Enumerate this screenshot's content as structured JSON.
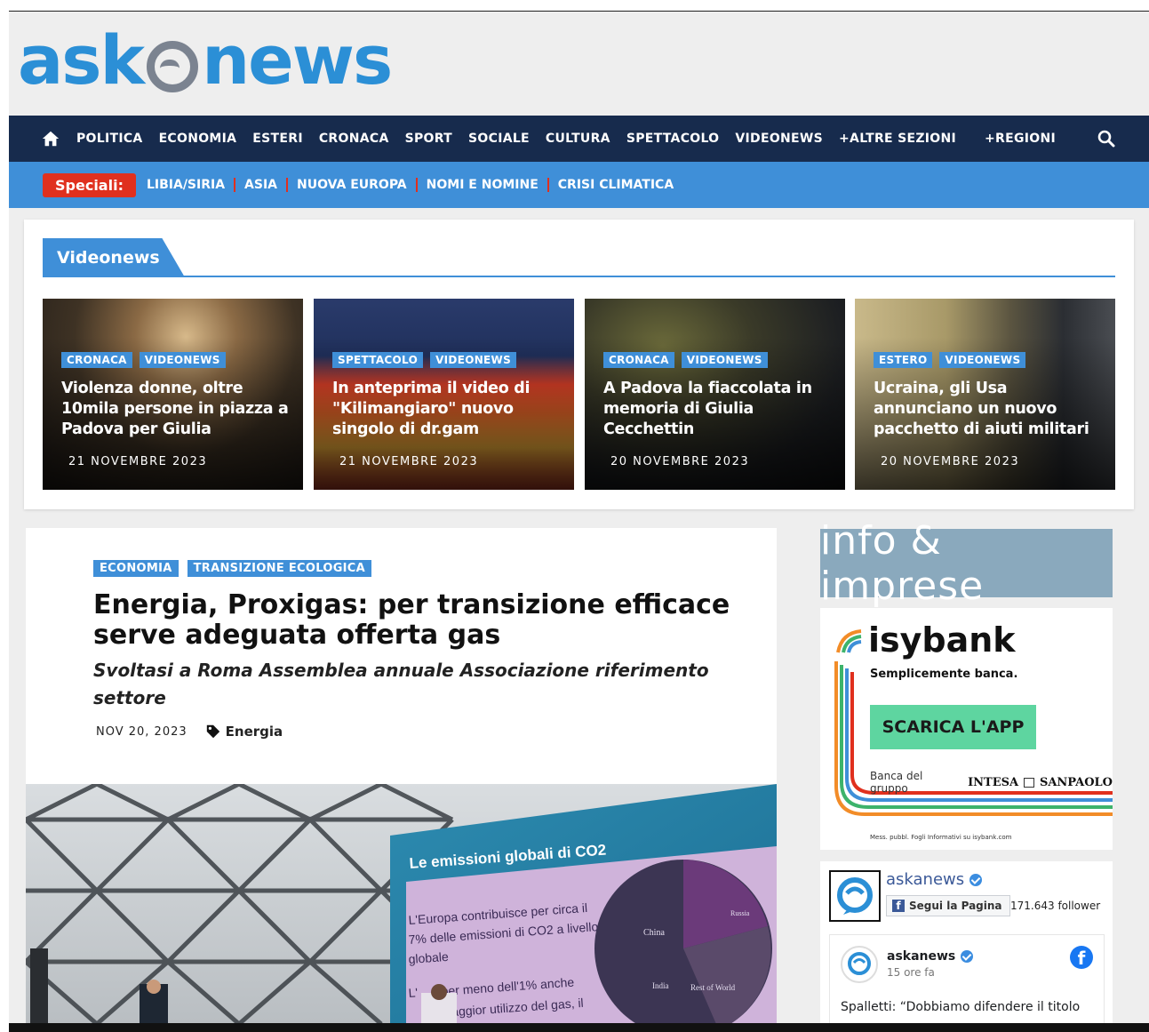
{
  "logo": {
    "text_left": "ask",
    "text_right": "news"
  },
  "nav": {
    "items": [
      "POLITICA",
      "ECONOMIA",
      "ESTERI",
      "CRONACA",
      "SPORT",
      "SOCIALE",
      "CULTURA",
      "SPETTACOLO",
      "VIDEONEWS",
      "+ALTRE SEZIONI"
    ],
    "regioni": "+REGIONI"
  },
  "speciali": {
    "label": "Speciali:",
    "items": [
      "LIBIA/SIRIA",
      "ASIA",
      "NUOVA EUROPA",
      "NOMI E NOMINE",
      "CRISI CLIMATICA"
    ]
  },
  "videonews": {
    "heading": "Videonews",
    "cards": [
      {
        "tags": [
          "CRONACA",
          "VIDEONEWS"
        ],
        "title": "Violenza donne, oltre 10mila persone in piazza a Padova per Giulia",
        "date": "21 NOVEMBRE 2023"
      },
      {
        "tags": [
          "SPETTACOLO",
          "VIDEONEWS"
        ],
        "title": "In anteprima il video di \"Kilimangiaro\" nuovo singolo di dr.gam",
        "date": "21 NOVEMBRE 2023"
      },
      {
        "tags": [
          "CRONACA",
          "VIDEONEWS"
        ],
        "title": "A Padova la fiaccolata in memoria di Giulia Cecchettin",
        "date": "20 NOVEMBRE 2023"
      },
      {
        "tags": [
          "ESTERO",
          "VIDEONEWS"
        ],
        "title": "Ucraina, gli Usa annunciano un nuovo pacchetto di aiuti militari",
        "date": "20 NOVEMBRE 2023"
      }
    ]
  },
  "article": {
    "tags": [
      "ECONOMIA",
      "TRANSIZIONE ECOLOGICA"
    ],
    "title": "Energia, Proxigas: per transizione efficace serve adeguata offerta gas",
    "subtitle": "Svoltasi a Roma Assemblea annuale Associazione riferimento settore",
    "date": "NOV 20, 2023",
    "category": "Energia",
    "image": {
      "screen_title": "Le emissioni globali di CO2",
      "screen_text_1a": "L'Europa contribuisce per circa il",
      "screen_text_1b": "7% delle emissioni di CO2 a livello",
      "screen_text_1c": "globale",
      "screen_text_2a": "L'",
      "screen_text_2b": "per meno dell'1% anche",
      "screen_text_2c": "maggior utilizzo del gas, il",
      "chart_labels": [
        "China",
        "India",
        "Rest of World",
        "Russia"
      ]
    }
  },
  "sidebar": {
    "ad1": {
      "text": "info & imprese"
    },
    "ad2": {
      "brand": "isybank",
      "claim": "Semplicemente banca.",
      "button": "SCARICA L'APP",
      "group_prefix": "Banca del gruppo",
      "group_name_1": "INTESA",
      "group_name_2": "SANPAOLO",
      "footnote": "Mess. pubbl. Fogli Informativi su isybank.com"
    },
    "facebook": {
      "page_name": "askanews",
      "follow_button": "Segui la Pagina",
      "followers": "171.643 follower",
      "post_author": "askanews",
      "post_time": "15 ore fa",
      "post_text": "Spalletti: “Dobbiamo difendere il titolo"
    }
  },
  "colors": {
    "nav_bg": "#172b4d",
    "spec_bg": "#3f8fd8",
    "accent_red": "#e0301e",
    "tag_blue": "#3f8fd8",
    "logo_blue": "#2b8fd6",
    "cta_green": "#5ed5a0"
  }
}
